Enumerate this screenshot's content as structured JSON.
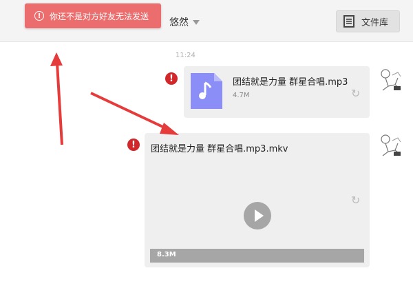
{
  "toast": {
    "message": "你还不是对方好友无法发送",
    "icon": "exclamation-circle-icon"
  },
  "header": {
    "contact_name": "悠然",
    "file_library_label": "文件库"
  },
  "chat": {
    "timestamp": "11:24",
    "messages": [
      {
        "type": "audio",
        "file_name": "团结就是力量 群星合唱.mp3",
        "size": "4.7M",
        "status": "failed"
      },
      {
        "type": "video",
        "file_name": "团结就是力量 群星合唱.mp3.mkv",
        "size": "8.3M",
        "status": "failed"
      }
    ]
  },
  "colors": {
    "toast_bg": "#ec6d6d",
    "error_red": "#d2272b",
    "arrow_red": "#e63b3b",
    "doc_icon": "#8b8ef6"
  }
}
